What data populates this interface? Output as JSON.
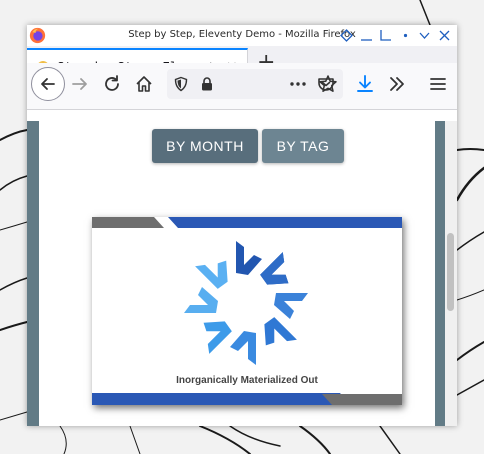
{
  "window": {
    "title": "Step by Step, Eleventy Demo - Mozilla Firefox"
  },
  "tab": {
    "title": "Step by Step, Eleventy Demo",
    "close": "×"
  },
  "toolbar": {
    "new_tab": "+"
  },
  "page": {
    "buttons": [
      {
        "label": "BY MONTH"
      },
      {
        "label": "BY TAG"
      }
    ],
    "banner": {
      "caption": "Inorganically Materialized Out"
    }
  },
  "colors": {
    "page_background": "#627b86",
    "button_month": "#586e7c",
    "button_tag": "#6d8592",
    "accent_blue": "#0a84ff",
    "logo_dark_blue": "#1e50b0",
    "logo_light_blue": "#3d9be9"
  },
  "icons": [
    "firefox-icon",
    "restore-icon",
    "minimize-icon",
    "maximize-icon",
    "dot-icon",
    "chevron-down-icon",
    "close-icon",
    "back-icon",
    "forward-icon",
    "reload-icon",
    "home-icon",
    "shield-icon",
    "lock-icon",
    "more-icon",
    "pocket-icon",
    "bookmark-star-icon",
    "download-icon",
    "overflow-icon",
    "menu-icon"
  ]
}
